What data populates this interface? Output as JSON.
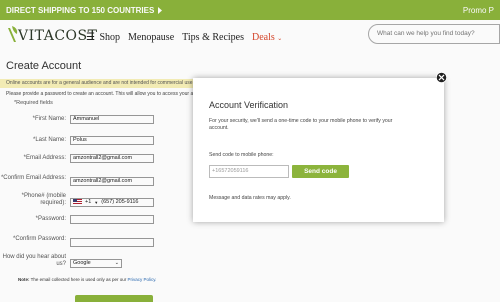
{
  "promo": {
    "left_text": "DIRECT SHIPPING TO 150 COUNTRIES",
    "left_icon": "chevron-right-icon",
    "right_text": "Promo P"
  },
  "header": {
    "logo_text": "VITACOST",
    "nav": {
      "shop": "Shop",
      "menopause": "Menopause",
      "tips": "Tips & Recipes",
      "deals": "Deals",
      "deals_icon": "chevron-down-icon"
    },
    "search_placeholder": "What can we help you find today?"
  },
  "page": {
    "title": "Create Account",
    "notice": "Online accounts are for a general audience and are not intended for commercial use.",
    "help": "Please provide a password to create an account. This will allow you to access your account.",
    "required": "*Required fields"
  },
  "form": {
    "first_name_label": "*First Name:",
    "first_name_value": "Ammanuel",
    "last_name_label": "*Last Name:",
    "last_name_value": "Polus",
    "email_label": "*Email Address:",
    "email_value": "amzontrall2@gmail.com",
    "confirm_email_label": "*Confirm Email Address:",
    "confirm_email_value": "amzontrall2@gmail.com",
    "phone_label": "*Phone# (mobile required):",
    "phone_value": "(657) 205-9116",
    "country_code": "+1",
    "password_label": "*Password:",
    "confirm_password_label": "*Confirm Password:",
    "hear_label": "How did you hear about us?",
    "hear_value": "Google",
    "note_prefix": "Note:",
    "note_text": "The email collected here is used only as per our",
    "note_link": "Privacy Policy."
  },
  "modal": {
    "title": "Account Verification",
    "description": "For your security, we'll send a one-time code to your mobile phone to verify your account.",
    "phone_label": "Send code to mobile phone:",
    "phone_value": "+16572059116",
    "send_button": "Send code",
    "rates": "Message and data rates may apply."
  },
  "colors": {
    "accent_green": "#8cb43c",
    "deals_red": "#d9462a",
    "notice_yellow": "#f7f0b8"
  }
}
